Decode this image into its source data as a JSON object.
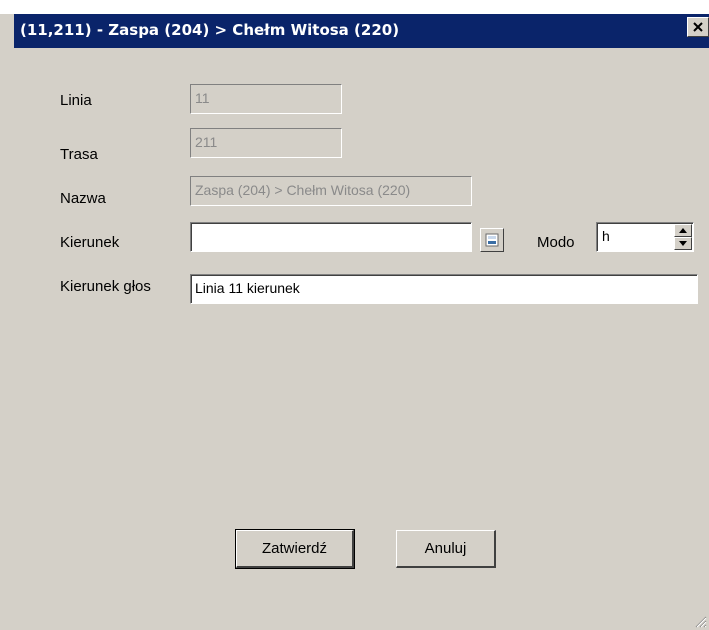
{
  "window": {
    "title": "(11,211) - Zaspa (204) > Chełm Witosa (220)",
    "close_symbol": "✕"
  },
  "form": {
    "linia": {
      "label": "Linia",
      "value": "11"
    },
    "trasa": {
      "label": "Trasa",
      "value": "211"
    },
    "nazwa": {
      "label": "Nazwa",
      "value": "Zaspa (204) > Chełm Witosa (220)"
    },
    "kierunek": {
      "label": "Kierunek",
      "value": ""
    },
    "modo": {
      "label": "Modo",
      "value": "h"
    },
    "kierunek_glos": {
      "label": "Kierunek głos",
      "value": "Linia 11 kierunek"
    }
  },
  "buttons": {
    "confirm": "Zatwierdź",
    "cancel": "Anuluj"
  },
  "icons": {
    "close": "close-icon",
    "picker": "picker-icon",
    "spin_up": "spin-up-icon",
    "spin_down": "spin-down-icon",
    "grip": "resize-grip-icon"
  },
  "colors": {
    "titlebar": "#0a246a",
    "face": "#d4d0c8",
    "disabled_text": "#8a8a8a"
  }
}
